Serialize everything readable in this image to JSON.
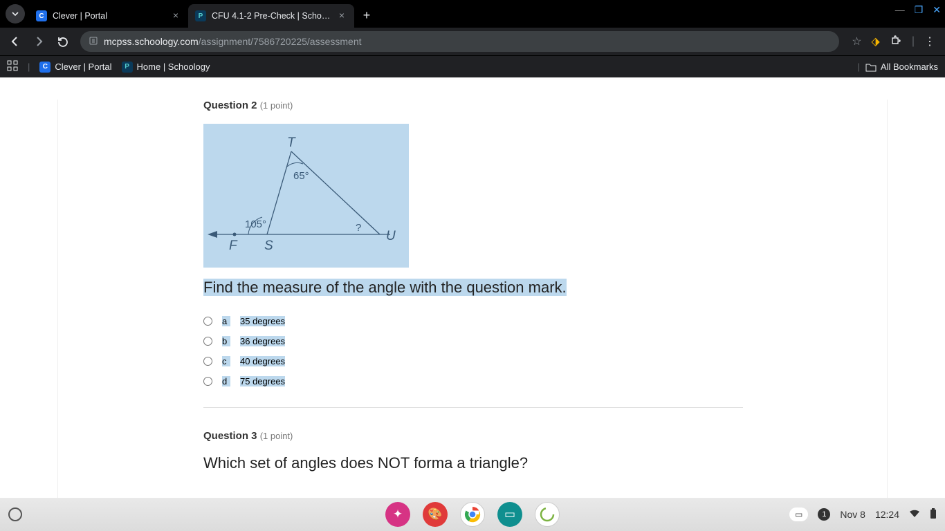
{
  "browser": {
    "tabs": [
      {
        "title": "Clever | Portal",
        "favicon_bg": "#1f6feb",
        "favicon_text": "C",
        "active": false
      },
      {
        "title": "CFU 4.1-2 Pre-Check | Schoology",
        "favicon_bg": "#0a3a5a",
        "favicon_text": "P",
        "active": true
      }
    ],
    "url_host": "mcpss.schoology.com",
    "url_path": "/assignment/7586720225/assessment",
    "bookmarks": [
      {
        "label": "Clever | Portal",
        "favicon_bg": "#1f6feb",
        "favicon_text": "C"
      },
      {
        "label": "Home | Schoology",
        "favicon_bg": "#0a3a5a",
        "favicon_text": "P"
      }
    ],
    "all_bookmarks": "All Bookmarks"
  },
  "question2": {
    "label": "Question 2",
    "points": "(1 point)",
    "figure": {
      "T": "T",
      "F": "F",
      "S": "S",
      "U": "U",
      "angle_top": "65°",
      "angle_left_ext": "105°",
      "angle_right": "?"
    },
    "prompt": "Find the measure of the angle with the question mark.",
    "choices": [
      {
        "letter": "a",
        "text": "35 degrees"
      },
      {
        "letter": "b",
        "text": "36 degrees"
      },
      {
        "letter": "c",
        "text": "40 degrees"
      },
      {
        "letter": "d",
        "text": "75 degrees"
      }
    ]
  },
  "question3": {
    "label": "Question 3",
    "points": "(1 point)",
    "prompt": "Which set of angles does NOT forma a triangle?"
  },
  "shelf": {
    "notif_count": "1",
    "date": "Nov 8",
    "time": "12:24"
  }
}
